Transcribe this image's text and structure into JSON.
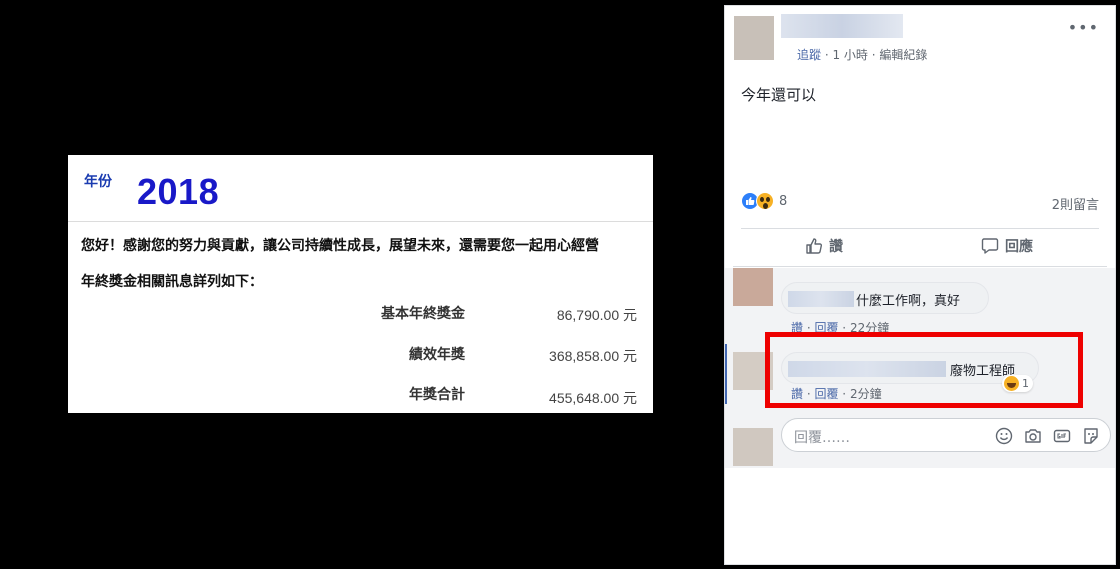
{
  "slip": {
    "year_label": "年份",
    "year_value": "2018",
    "greeting": "您好！感謝您的努力與貢獻，讓公司持續性成長，展望未來，還需要您一起用心經營",
    "intro": "年終獎金相關訊息詳列如下：",
    "rows": [
      {
        "label": "基本年終獎金",
        "value": "86,790.00 元"
      },
      {
        "label": "績效年獎",
        "value": "368,858.00 元"
      },
      {
        "label": "年獎合計",
        "value": "455,648.00 元"
      }
    ]
  },
  "post": {
    "meta_follow": "追蹤",
    "meta_time": " · 1 小時 · ",
    "meta_edit": "編輯紀錄",
    "more": "•••",
    "body": "今年還可以",
    "reaction_count": "8",
    "comment_count": "2則留言",
    "actions": {
      "like": "讚",
      "comment": "回應"
    },
    "comments": [
      {
        "text": "什麼工作啊，真好",
        "like": "讚",
        "reply": "回覆",
        "time": "22分鐘"
      },
      {
        "text": "廢物工程師",
        "like": "讚",
        "reply": "回覆",
        "time": "2分鐘",
        "reactions": "1"
      }
    ],
    "reply_placeholder": "回覆……",
    "reply_icons": [
      "emoji-icon",
      "camera-icon",
      "gif-icon",
      "sticker-icon"
    ]
  },
  "colors": {
    "highlight": "#ee0000",
    "link": "#4a68a8",
    "year": "#1919c8"
  }
}
